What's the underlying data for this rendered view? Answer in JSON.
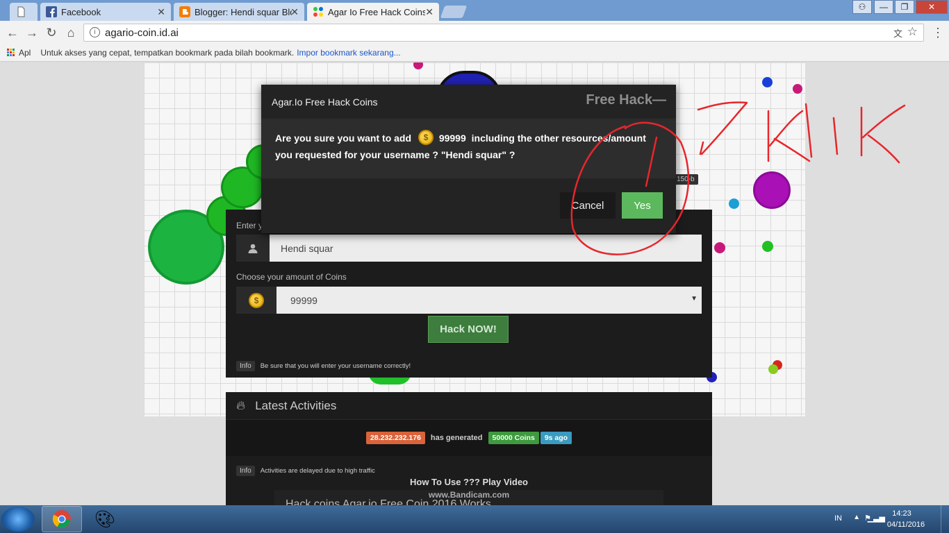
{
  "browser": {
    "tabs": [
      {
        "title": ""
      },
      {
        "title": "Facebook"
      },
      {
        "title": "Blogger: Hendi squar Blo"
      },
      {
        "title": "Agar Io Free Hack Coins"
      }
    ],
    "url": "agario-coin.id.ai",
    "bookmarks": {
      "apps": "Apl",
      "hint": "Untuk akses yang cepat, tempatkan bookmark pada bilah bookmark.",
      "import_link": "Impor bookmark sekarang..."
    }
  },
  "form": {
    "username_label": "Enter y",
    "username_value": "Hendi squar",
    "coins_label": "Choose your amount of Coins",
    "coins_value": "99999",
    "hack_button": "Hack NOW!",
    "info_badge": "Info",
    "info_text": "Be sure that you will enter your username correctly!"
  },
  "player_tag": "150-b",
  "activities": {
    "title": "Latest Activities",
    "ip": "28.232.232.176",
    "has_generated": "has generated",
    "coins": "50000 Coins",
    "ago": "9s ago",
    "info_badge": "Info",
    "info_text": "Activities are delayed due to high traffic",
    "video_title": "How To Use ??? Play Video",
    "video_overlay": "www.Bandicam.com",
    "video_caption": "Hack coins Agar.io Free Coin 2016 Works"
  },
  "modal": {
    "title": "Agar.Io Free Hack Coins",
    "brand": "Free Hack—",
    "msg_pre": "Are you sure you want to add",
    "msg_amount": "99999",
    "msg_post": "including the other resources/amount you requested for your username ? \"Hendi squar\" ?",
    "cancel": "Cancel",
    "yes": "Yes"
  },
  "annotation": {
    "text": "Klik",
    "color": "#e8262b"
  },
  "taskbar": {
    "lang": "IN",
    "time": "14:23",
    "date": "04/11/2016"
  }
}
